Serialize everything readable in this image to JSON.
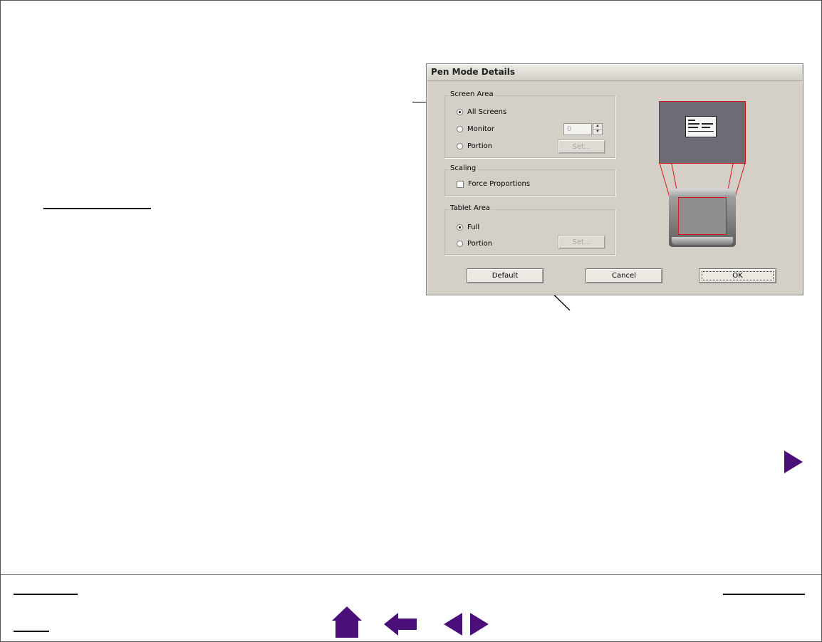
{
  "dialog": {
    "title": "Pen Mode Details",
    "screen_area": {
      "label": "Screen Area",
      "options": [
        "All Screens",
        "Monitor",
        "Portion"
      ],
      "selected": "All Screens",
      "monitor_value": "0",
      "set_button": "Set..."
    },
    "scaling": {
      "label": "Scaling",
      "force_proportions": "Force Proportions",
      "force_proportions_checked": false
    },
    "tablet_area": {
      "label": "Tablet Area",
      "options": [
        "Full",
        "Portion"
      ],
      "selected": "Full",
      "set_button": "Set..."
    },
    "buttons": {
      "default": "Default",
      "cancel": "Cancel",
      "ok": "OK"
    }
  },
  "colors": {
    "nav_accent": "#4b0f7a",
    "mapping_outline": "#d41818"
  },
  "icons": {
    "next": "triangle-right-icon",
    "home": "home-icon",
    "back": "arrow-left-icon",
    "prev_page": "triangle-left-icon",
    "next_page": "triangle-right-icon"
  }
}
